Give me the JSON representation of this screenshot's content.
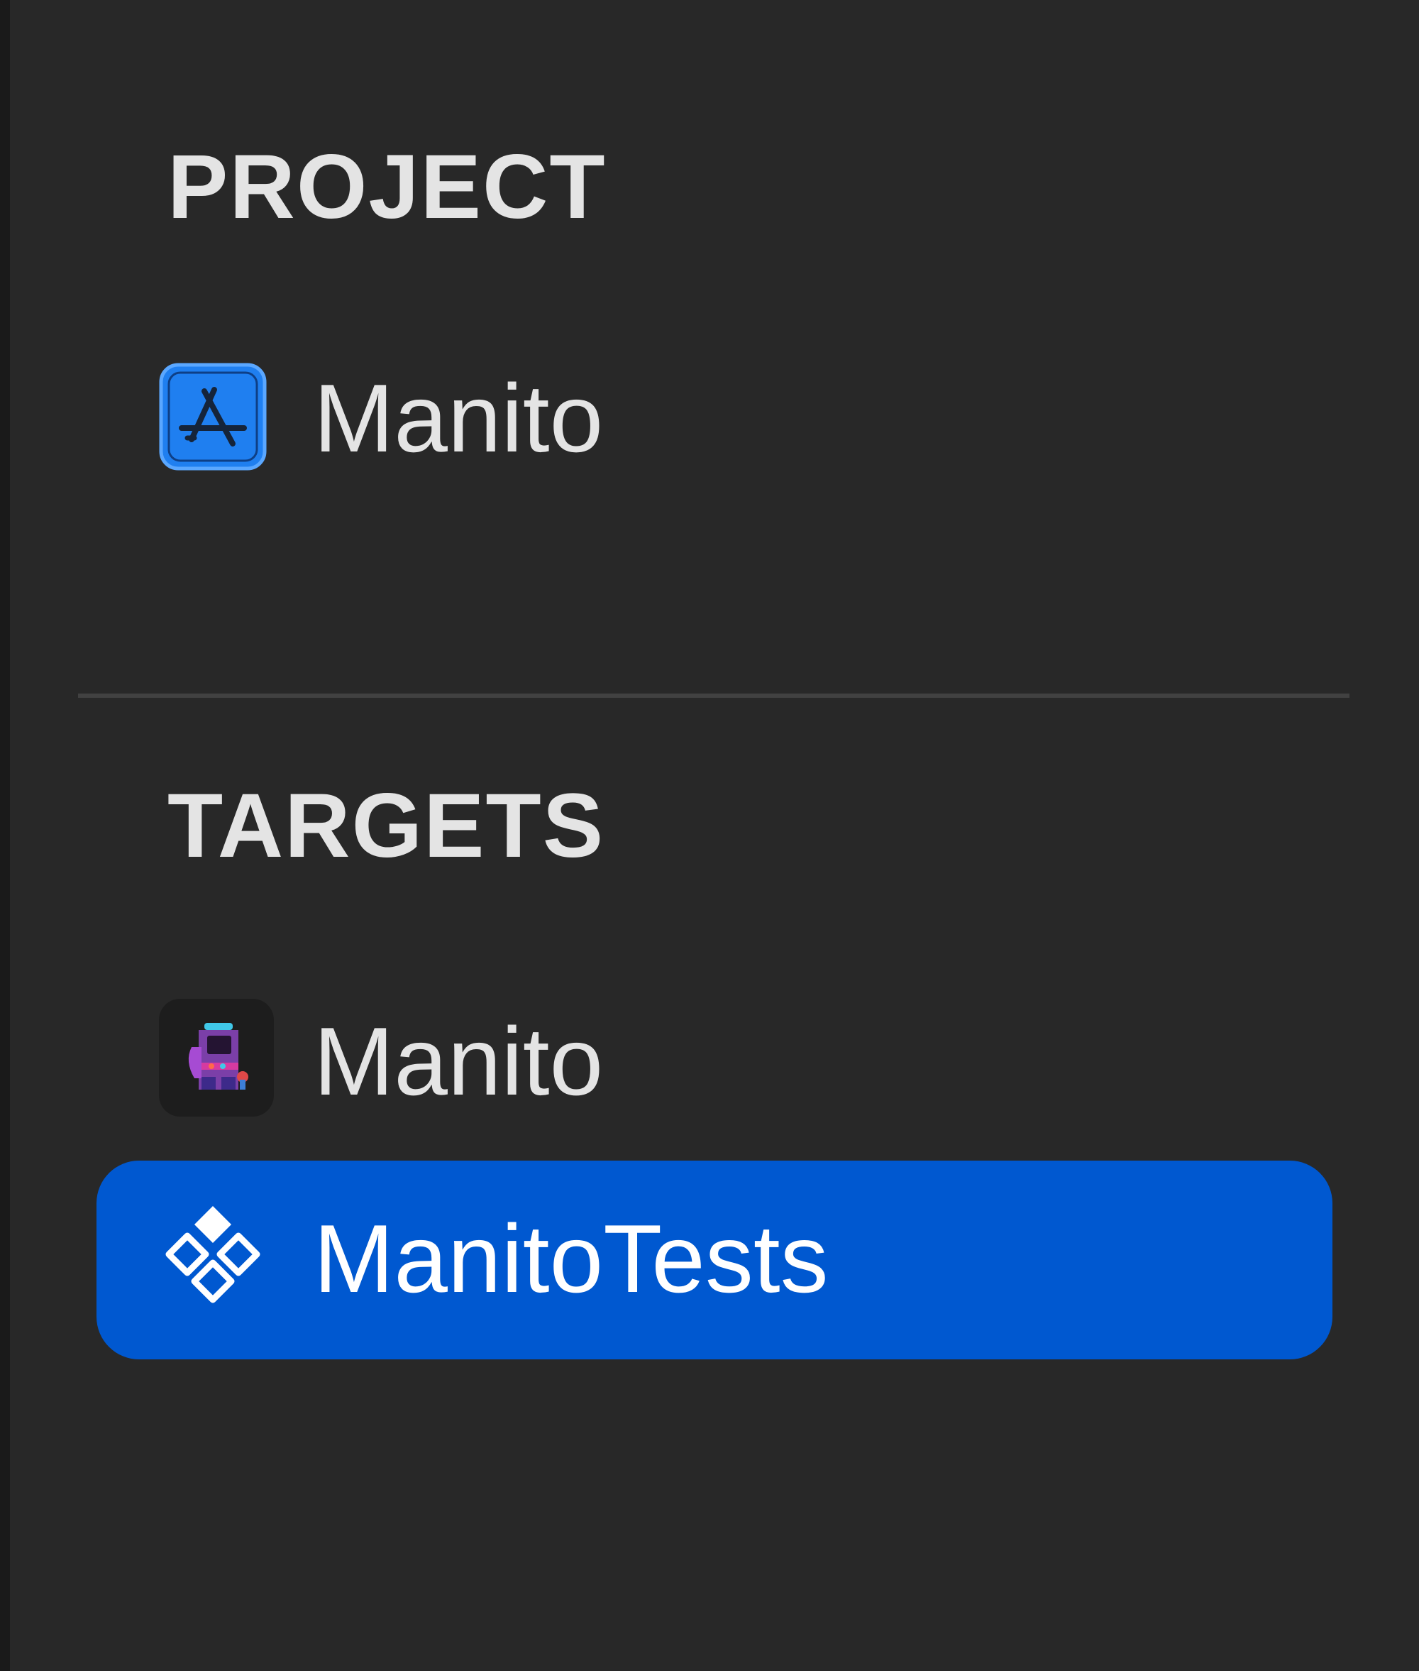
{
  "sections": {
    "project": {
      "header": "PROJECT",
      "items": [
        {
          "label": "Manito",
          "icon": "app-store-icon",
          "selected": false
        }
      ]
    },
    "targets": {
      "header": "TARGETS",
      "items": [
        {
          "label": "Manito",
          "icon": "arcade-app-icon",
          "selected": false
        },
        {
          "label": "ManitoTests",
          "icon": "test-bundle-icon",
          "selected": true
        }
      ]
    }
  },
  "colors": {
    "background": "#282828",
    "selection": "#0058d0",
    "text": "#e4e4e4",
    "selected_text": "#ffffff",
    "project_icon": "#1f7ff0"
  }
}
